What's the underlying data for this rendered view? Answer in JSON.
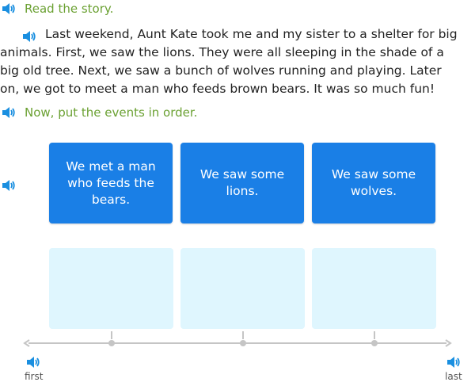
{
  "instructions": {
    "read": "Read the story.",
    "order": "Now, put the events in order."
  },
  "story": {
    "lines": [
      "Last weekend, Aunt Kate took me and my sister to a shelter for big",
      "animals. First, we saw the lions. They were all sleeping in the shade of a",
      "big old tree. Next, we saw a bunch of wolves running and playing. Later",
      "on, we got to meet a man who feeds brown bears. It was so much fun!"
    ]
  },
  "cards": [
    {
      "label": "We met a man who feeds the bears."
    },
    {
      "label": "We saw some lions."
    },
    {
      "label": "We saw some wolves."
    }
  ],
  "timeline": {
    "first_label": "first",
    "last_label": "last"
  },
  "colors": {
    "instruction_green": "#6ba133",
    "speaker_blue": "#1a8fe0",
    "card_blue": "#1a7fe6",
    "slot_bg": "#dff6fe",
    "axis_gray": "#c5c5c5"
  },
  "icons": {
    "speaker": "speaker-icon"
  }
}
